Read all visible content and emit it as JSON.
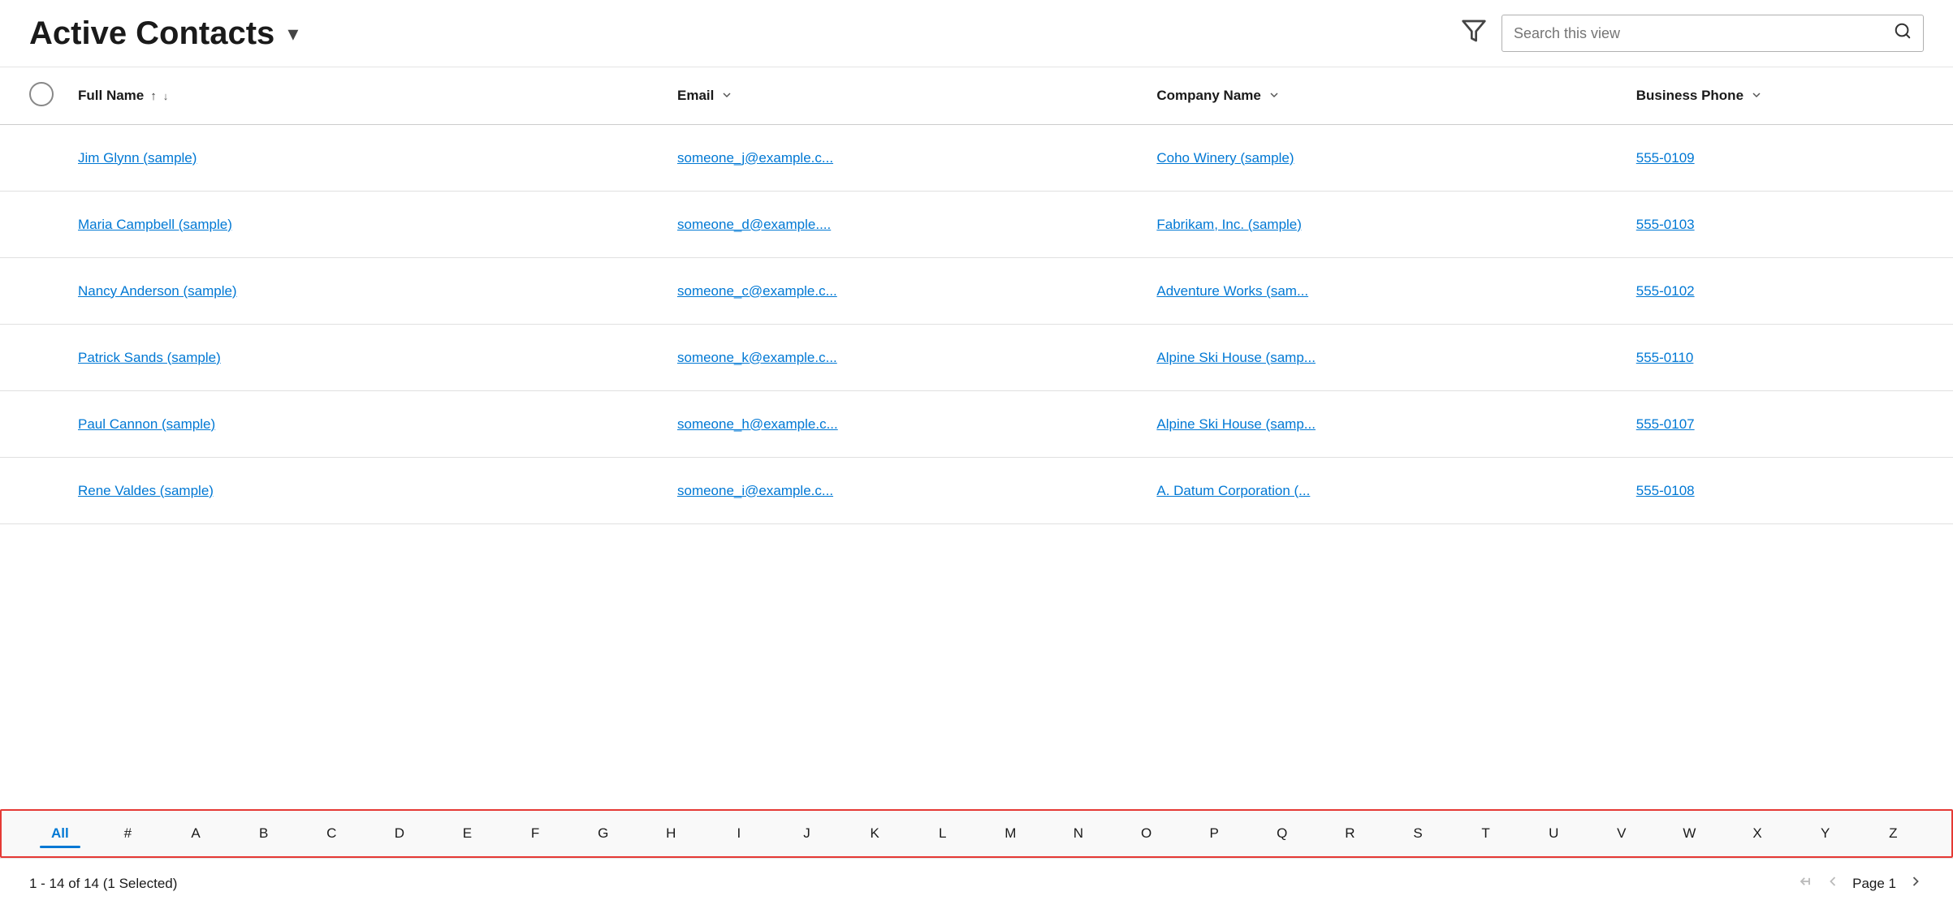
{
  "header": {
    "title": "Active Contacts",
    "dropdown_icon": "▾",
    "filter_icon": "⛉",
    "search_placeholder": "Search this view",
    "search_icon": "🔍"
  },
  "columns": {
    "fullname": "Full Name",
    "email": "Email",
    "company": "Company Name",
    "phone": "Business Phone"
  },
  "rows": [
    {
      "fullname": "Jim Glynn (sample)",
      "email": "someone_j@example.c...",
      "company": "Coho Winery (sample)",
      "phone": "555-0109"
    },
    {
      "fullname": "Maria Campbell (sample)",
      "email": "someone_d@example....",
      "company": "Fabrikam, Inc. (sample)",
      "phone": "555-0103"
    },
    {
      "fullname": "Nancy Anderson (sample)",
      "email": "someone_c@example.c...",
      "company": "Adventure Works (sam...",
      "phone": "555-0102"
    },
    {
      "fullname": "Patrick Sands (sample)",
      "email": "someone_k@example.c...",
      "company": "Alpine Ski House (samp...",
      "phone": "555-0110"
    },
    {
      "fullname": "Paul Cannon (sample)",
      "email": "someone_h@example.c...",
      "company": "Alpine Ski House (samp...",
      "phone": "555-0107"
    },
    {
      "fullname": "Rene Valdes (sample)",
      "email": "someone_i@example.c...",
      "company": "A. Datum Corporation (...",
      "phone": "555-0108"
    }
  ],
  "alpha": [
    "All",
    "#",
    "A",
    "B",
    "C",
    "D",
    "E",
    "F",
    "G",
    "H",
    "I",
    "J",
    "K",
    "L",
    "M",
    "N",
    "O",
    "P",
    "Q",
    "R",
    "S",
    "T",
    "U",
    "V",
    "W",
    "X",
    "Y",
    "Z"
  ],
  "footer": {
    "count": "1 - 14 of 14 (1 Selected)",
    "page_label": "Page 1"
  }
}
